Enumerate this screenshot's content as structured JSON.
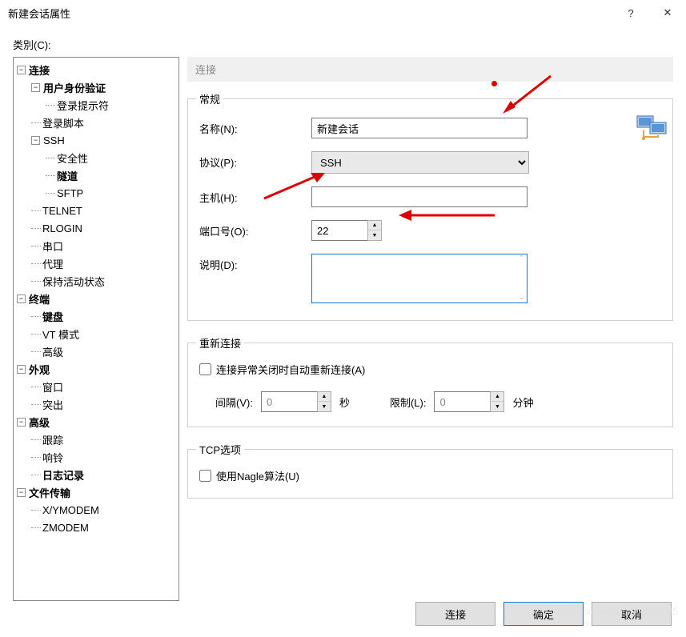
{
  "titlebar": {
    "title": "新建会话属性",
    "help": "?",
    "close": "✕"
  },
  "category_label": "类別(C):",
  "tree": [
    {
      "label": "连接",
      "bold": true,
      "depth": 0,
      "expander": "−",
      "children": [
        {
          "label": "用户身份验证",
          "bold": true,
          "depth": 1,
          "expander": "−",
          "children": [
            {
              "label": "登录提示符",
              "depth": 2
            }
          ]
        },
        {
          "label": "登录脚本",
          "depth": 1
        },
        {
          "label": "SSH",
          "depth": 1,
          "expander": "−",
          "children": [
            {
              "label": "安全性",
              "depth": 2
            },
            {
              "label": "隧道",
              "bold": true,
              "depth": 2
            },
            {
              "label": "SFTP",
              "depth": 2
            }
          ]
        },
        {
          "label": "TELNET",
          "depth": 1
        },
        {
          "label": "RLOGIN",
          "depth": 1
        },
        {
          "label": "串口",
          "depth": 1
        },
        {
          "label": "代理",
          "depth": 1
        },
        {
          "label": "保持活动状态",
          "depth": 1
        }
      ]
    },
    {
      "label": "终端",
      "bold": true,
      "depth": 0,
      "expander": "−",
      "children": [
        {
          "label": "键盘",
          "bold": true,
          "depth": 1
        },
        {
          "label": "VT 模式",
          "depth": 1
        },
        {
          "label": "高级",
          "depth": 1
        }
      ]
    },
    {
      "label": "外观",
      "bold": true,
      "depth": 0,
      "expander": "−",
      "children": [
        {
          "label": "窗口",
          "depth": 1
        },
        {
          "label": "突出",
          "depth": 1
        }
      ]
    },
    {
      "label": "高级",
      "bold": true,
      "depth": 0,
      "expander": "−",
      "children": [
        {
          "label": "跟踪",
          "depth": 1
        },
        {
          "label": "响铃",
          "depth": 1
        },
        {
          "label": "日志记录",
          "bold": true,
          "depth": 1
        }
      ]
    },
    {
      "label": "文件传输",
      "bold": true,
      "depth": 0,
      "expander": "−",
      "children": [
        {
          "label": "X/YMODEM",
          "depth": 1
        },
        {
          "label": "ZMODEM",
          "depth": 1
        }
      ]
    }
  ],
  "panel_header": "连接",
  "general": {
    "legend": "常规",
    "name_label": "名称(N):",
    "name_value": "新建会话",
    "protocol_label": "协议(P):",
    "protocol_value": "SSH",
    "host_label": "主机(H):",
    "host_value": "",
    "port_label": "端口号(O):",
    "port_value": "22",
    "desc_label": "说明(D):",
    "desc_value": ""
  },
  "reconnect": {
    "legend": "重新连接",
    "checkbox_label": "连接异常关闭时自动重新连接(A)",
    "interval_label": "间隔(V):",
    "interval_value": "0",
    "interval_unit": "秒",
    "limit_label": "限制(L):",
    "limit_value": "0",
    "limit_unit": "分钟"
  },
  "tcp": {
    "legend": "TCP选项",
    "nagle_label": "使用Nagle算法(U)"
  },
  "buttons": {
    "connect": "连接",
    "ok": "确定",
    "cancel": "取消"
  },
  "watermark": "https://blog.csdn.net/H1005654545"
}
